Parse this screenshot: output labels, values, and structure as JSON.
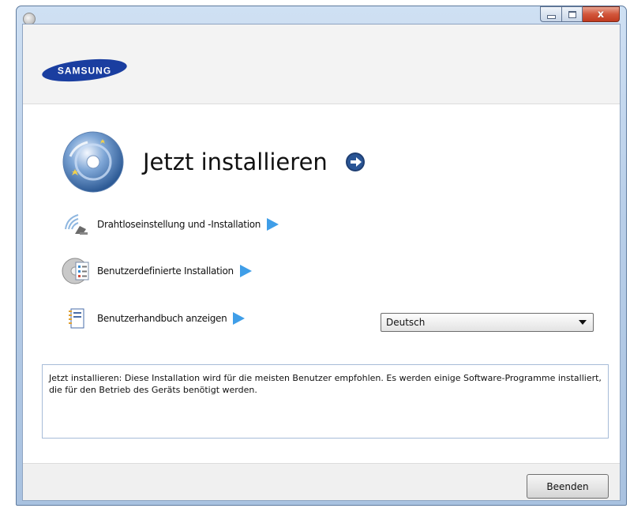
{
  "window": {
    "title": "",
    "minimize_icon": "minimize-icon",
    "maximize_icon": "maximize-icon",
    "close_icon": "close-icon",
    "close_glyph": "x"
  },
  "header": {
    "brand": "SAMSUNG"
  },
  "main_action": {
    "title": "Jetzt installieren",
    "icon": "install-disc-icon",
    "go_icon": "arrow-right-circle-icon"
  },
  "options": [
    {
      "label": "Drahtloseinstellung und -Installation",
      "icon": "wireless-satellite-icon"
    },
    {
      "label": "Benutzerdefinierte Installation",
      "icon": "custom-install-cd-icon"
    },
    {
      "label": "Benutzerhandbuch anzeigen",
      "icon": "user-manual-book-icon"
    }
  ],
  "language": {
    "selected": "Deutsch"
  },
  "description": {
    "text": "Jetzt installieren: Diese Installation wird für die meisten Benutzer empfohlen. Es werden einige Software-Programme installiert, die für den Betrieb des Geräts benötigt werden."
  },
  "footer": {
    "finish_label": "Beenden"
  },
  "colors": {
    "accent_arrow": "#3f9ee8",
    "brand_blue": "#1a3ea0"
  }
}
